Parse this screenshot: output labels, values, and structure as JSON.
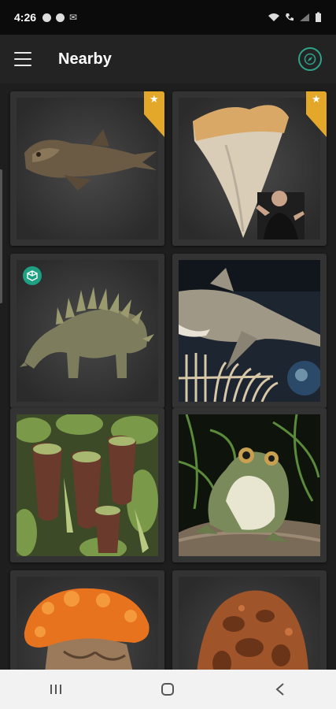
{
  "status_bar": {
    "time": "4:26"
  },
  "app_bar": {
    "title": "Nearby"
  },
  "icons": {
    "menu": "hamburger-menu-icon",
    "compass": "compass-icon",
    "featured": "star-icon",
    "ar": "augmented-reality-icon",
    "nav_recents": "recents-icon",
    "nav_home": "home-icon",
    "nav_back": "back-icon"
  },
  "colors": {
    "accent": "#2fa38a",
    "featured_ribbon": "#e3a82a",
    "ar_badge": "#1fa083"
  },
  "items": [
    {
      "subject": "fossil fish",
      "featured": true,
      "ar": false
    },
    {
      "subject": "megalodon tooth",
      "featured": true,
      "ar": false
    },
    {
      "subject": "stegosaur",
      "featured": false,
      "ar": true
    },
    {
      "subject": "shark exhibit",
      "featured": false,
      "ar": false
    },
    {
      "subject": "pitcher plants",
      "featured": false,
      "ar": false
    },
    {
      "subject": "frog",
      "featured": false,
      "ar": false
    },
    {
      "subject": "orange fungus",
      "featured": false,
      "ar": false
    },
    {
      "subject": "termite mound",
      "featured": false,
      "ar": false
    }
  ]
}
